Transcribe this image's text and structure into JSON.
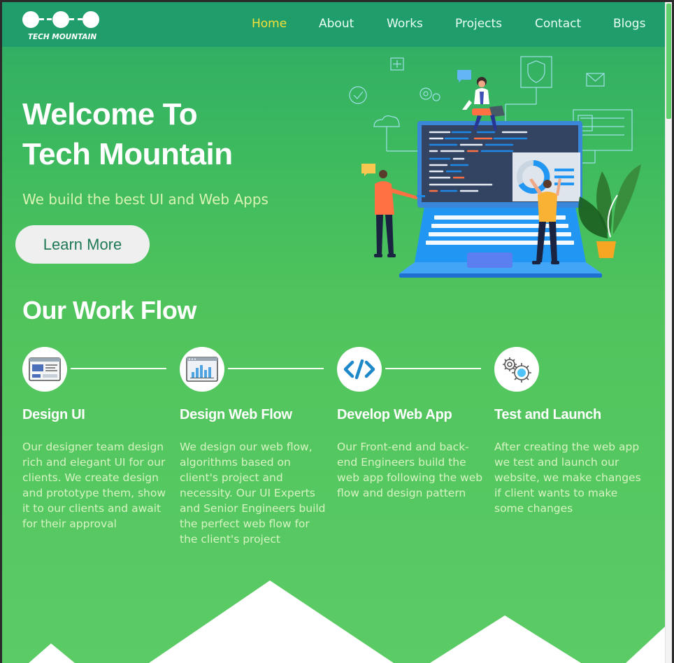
{
  "brand": {
    "logo_text": "TECH MOUNTAIN"
  },
  "nav": {
    "items": [
      {
        "label": "Home",
        "active": true
      },
      {
        "label": "About",
        "active": false
      },
      {
        "label": "Works",
        "active": false
      },
      {
        "label": "Projects",
        "active": false
      },
      {
        "label": "Contact",
        "active": false
      },
      {
        "label": "Blogs",
        "active": false
      }
    ]
  },
  "hero": {
    "title_line1": "Welcome To",
    "title_line2": "Tech Mountain",
    "subtitle": "We build the best UI and Web Apps",
    "cta_label": "Learn More"
  },
  "workflow": {
    "title": "Our Work Flow",
    "steps": [
      {
        "icon": "design-ui-icon",
        "title": "Design UI",
        "text": "Our designer team design rich and elegant UI for our clients. We create design and prototype them, show it to our clients and await for their approval"
      },
      {
        "icon": "web-flow-chart-icon",
        "title": "Design Web Flow",
        "text": "We design our web flow, algorithms based on client's project and necessity. Our UI Experts and Senior Engineers build the perfect web flow for the client's project"
      },
      {
        "icon": "code-icon",
        "title": "Develop Web App",
        "text": "Our Front-end and back-end Engineers build the web app following the web flow and design pattern"
      },
      {
        "icon": "gears-icon",
        "title": "Test and Launch",
        "text": "After creating the web app we test and launch our website, we make changes if client wants to make some changes"
      }
    ]
  },
  "colors": {
    "nav_bg": "#1f9e6b",
    "active_nav": "#f4e03a",
    "accent_blue": "#1e88c8",
    "page_green": "#50c45c"
  }
}
